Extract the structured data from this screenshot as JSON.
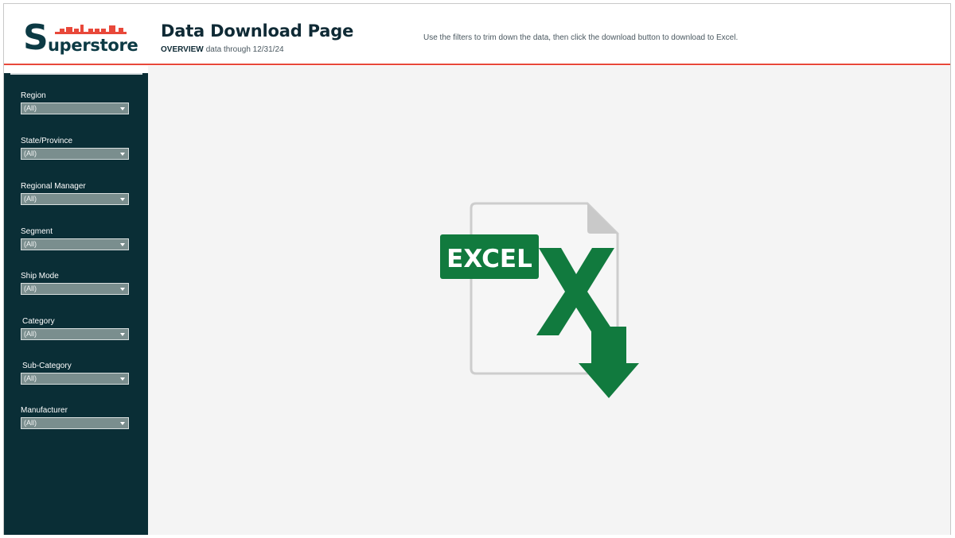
{
  "header": {
    "logo_initial": "S",
    "logo_rest": "uperstore",
    "title": "Data Download Page",
    "subtitle_keyword": "OVERVIEW",
    "subtitle_text": "data through 12/31/24",
    "instructions": "Use the filters to trim down the data, then click the download button to download to Excel."
  },
  "filters": [
    {
      "label": "Region",
      "value": "(All)"
    },
    {
      "label": "State/Province",
      "value": "(All)"
    },
    {
      "label": "Regional Manager",
      "value": "(All)"
    },
    {
      "label": "Segment",
      "value": "(All)"
    },
    {
      "label": "Ship Mode",
      "value": "(All)"
    },
    {
      "label": "Category",
      "value": "(All)"
    },
    {
      "label": "Sub-Category",
      "value": "(All)"
    },
    {
      "label": "Manufacturer",
      "value": "(All)"
    }
  ],
  "download": {
    "badge_text": "EXCEL",
    "icon": "excel-download-icon"
  },
  "colors": {
    "brand_navy": "#0a2e36",
    "accent_red": "#e8483a",
    "excel_green": "#117a3e"
  }
}
